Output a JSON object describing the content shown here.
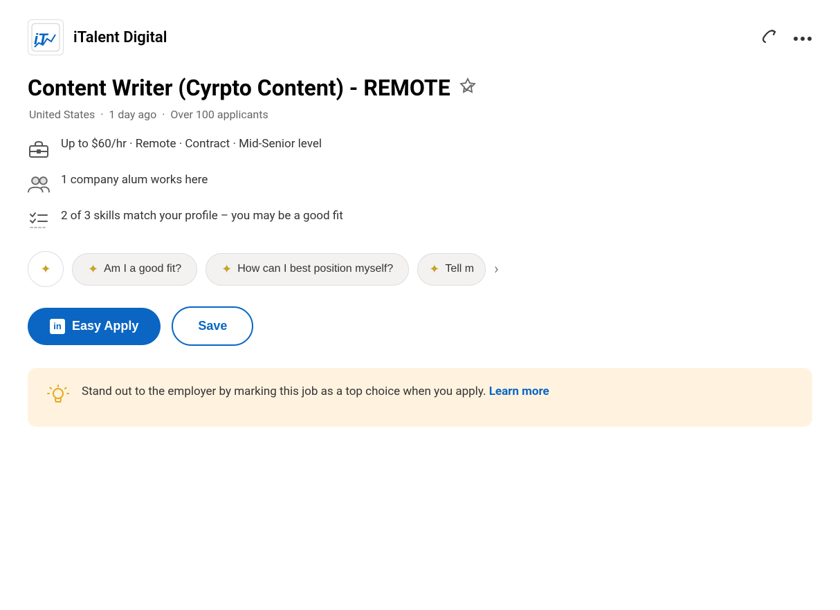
{
  "header": {
    "company_logo_text": "iT",
    "company_name": "iTalent Digital",
    "share_icon": "↪",
    "more_icon": "···"
  },
  "job": {
    "title": "Content Writer (Cyrpto Content) - REMOTE",
    "location": "United States",
    "posted": "1 day ago",
    "applicants": "Over 100 applicants",
    "pay": "Up to $60/hr",
    "workplace": "Remote",
    "job_type": "Contract",
    "level": "Mid-Senior level",
    "alum_text": "1 company alum works here",
    "skills_text": "2 of 3 skills match your profile – you may be a good fit"
  },
  "ai_prompts": {
    "am_i_fit": "Am I a good fit?",
    "position_myself": "How can I best position myself?",
    "tell_more": "Tell m"
  },
  "actions": {
    "easy_apply": "Easy Apply",
    "save": "Save"
  },
  "banner": {
    "text": "Stand out to the employer by marking this job as a top choice when you apply.",
    "learn_more": "Learn more"
  }
}
